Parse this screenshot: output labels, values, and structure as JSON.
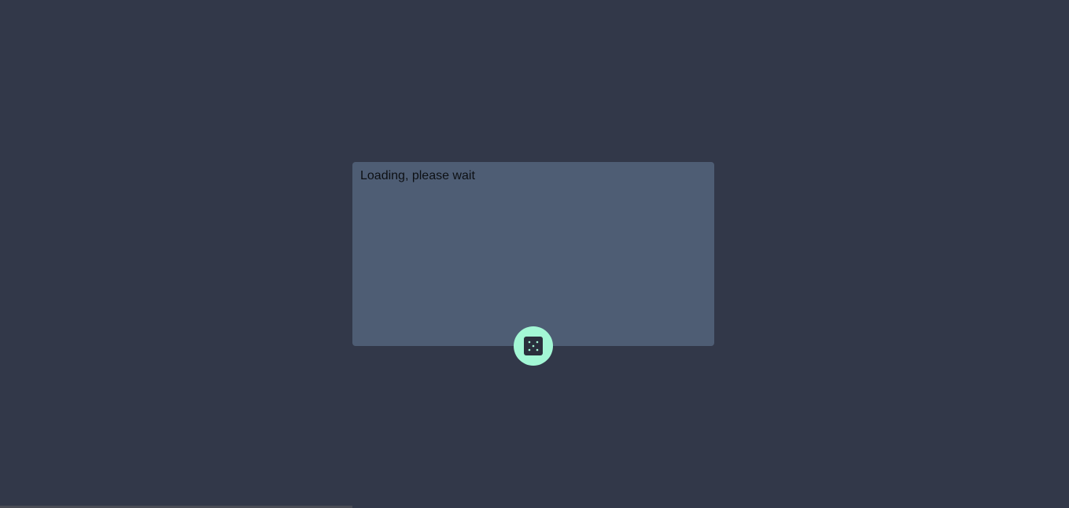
{
  "dialog": {
    "message": "Loading, please wait"
  },
  "action": {
    "icon": "dice-icon",
    "button_color": "#a3f7d5",
    "icon_color": "#2a2f3c"
  },
  "theme": {
    "background": "#323849",
    "card": "#4e5d74"
  }
}
